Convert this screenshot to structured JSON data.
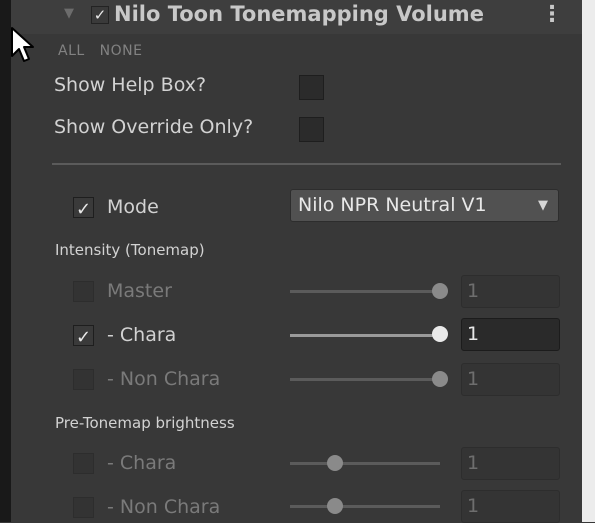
{
  "header": {
    "title": "Nilo Toon Tonemapping Volume",
    "kebab": "⋮",
    "foldout": "▼",
    "enabled": "✓"
  },
  "allnone": {
    "all": "ALL",
    "none": "NONE"
  },
  "options": {
    "show_help": "Show Help Box?",
    "show_override": "Show Override Only?"
  },
  "mode": {
    "check": "✓",
    "label": "Mode",
    "value": "Nilo NPR Neutral V1",
    "caret": "▼"
  },
  "intensity": {
    "section": "Intensity (Tonemap)",
    "rows": [
      {
        "label": "Master",
        "value": "1",
        "check": ""
      },
      {
        "label": "-   Chara",
        "value": "1",
        "check": "✓"
      },
      {
        "label": "-   Non Chara",
        "value": "1",
        "check": ""
      }
    ]
  },
  "pre": {
    "section": "Pre-Tonemap brightness",
    "rows": [
      {
        "label": "-   Chara",
        "value": "1"
      },
      {
        "label": "-   Non Chara",
        "value": "1"
      }
    ]
  },
  "colors": {
    "background": "#383838",
    "header": "#3e3e3e",
    "text": "#d2d2d2",
    "dim_text": "#7a7a7a"
  },
  "icons": {
    "cursor": "mouse-pointer-icon",
    "check": "checkmark-icon",
    "menu": "kebab-menu-icon"
  }
}
